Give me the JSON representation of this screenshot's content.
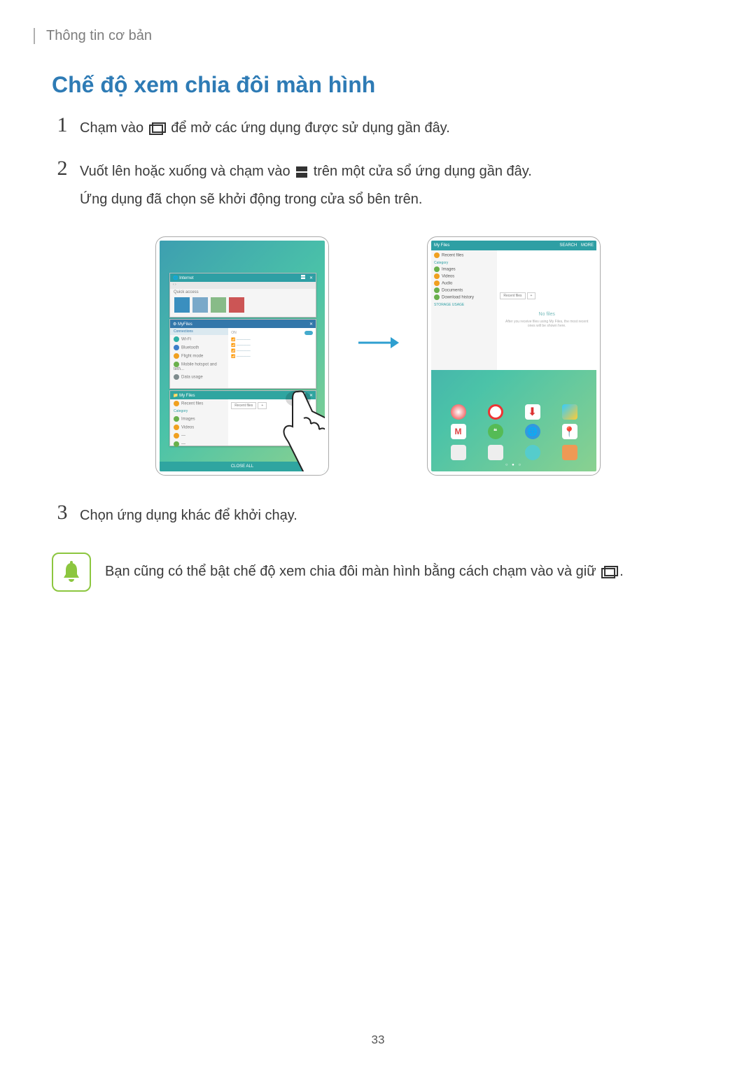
{
  "breadcrumb": "Thông tin cơ bản",
  "section_title": "Chế độ xem chia đôi màn hình",
  "steps": {
    "s1": {
      "num": "1",
      "pre": "Chạm vào ",
      "post": " để mở các ứng dụng được sử dụng gần đây."
    },
    "s2": {
      "num": "2",
      "line1_pre": "Vuốt lên hoặc xuống và chạm vào ",
      "line1_post": " trên một cửa sổ ứng dụng gần đây.",
      "line2": "Ứng dụng đã chọn sẽ khởi động trong cửa sổ bên trên."
    },
    "s3": {
      "num": "3",
      "text": "Chọn ứng dụng khác để khởi chạy."
    }
  },
  "note": {
    "pre": "Bạn cũng có thể bật chế độ xem chia đôi màn hình bằng cách chạm vào và giữ ",
    "post": "."
  },
  "left_tablet": {
    "card1": {
      "title": "Internet",
      "subtext": "Quick access"
    },
    "card2": {
      "title": "MyFiles",
      "items": [
        "Wi-Fi",
        "Bluetooth",
        "Flight mode",
        "Mobile hotspot and teth...",
        "Data usage"
      ]
    },
    "card3": {
      "title": "My Files",
      "items": [
        "Recent files",
        "Images",
        "Videos"
      ],
      "tab": "Recent files"
    },
    "close_all": "CLOSE ALL"
  },
  "right_tablet": {
    "header": "My Files",
    "header_actions": [
      "SEARCH",
      "MORE"
    ],
    "sidebar": {
      "items": [
        "Recent files"
      ],
      "cat1_label": "Category",
      "cat1": [
        "Images",
        "Videos",
        "Audio",
        "Documents",
        "Download history"
      ],
      "cat2_label": "STORAGE USAGE"
    },
    "content": {
      "tab": "Recent files",
      "plus": "+",
      "title": "No files",
      "sub": "After you receive files using My Files, the most recent ones will be shown here."
    },
    "dots": "○ ● ○"
  },
  "page_number": "33"
}
